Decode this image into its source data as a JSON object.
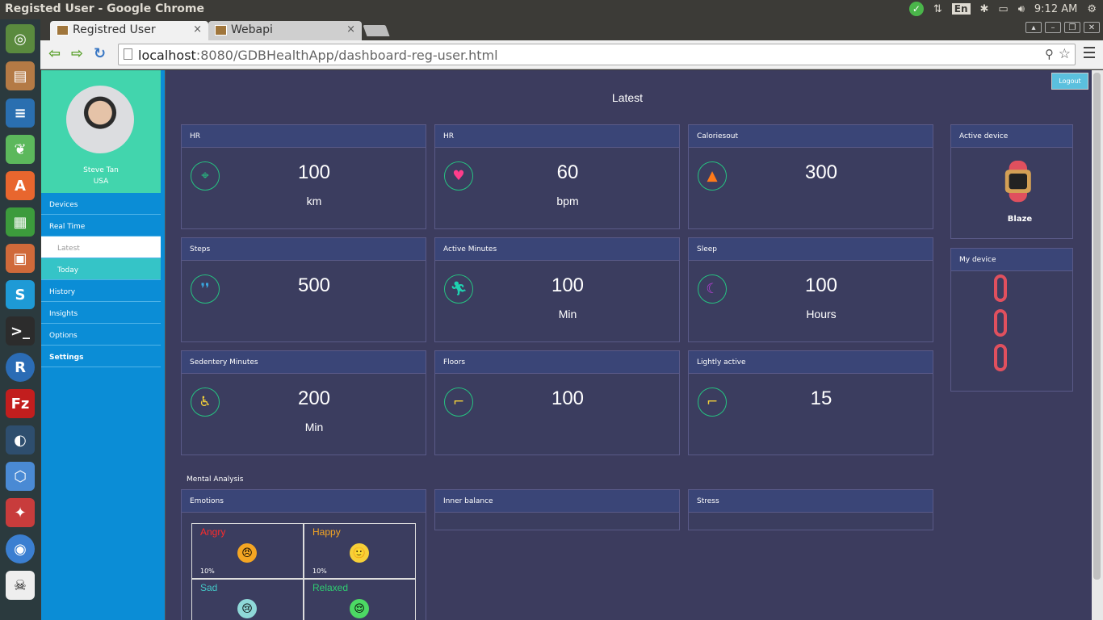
{
  "os": {
    "window_title": "Registed User - Google Chrome",
    "keyboard": "En",
    "time": "9:12 AM"
  },
  "browser": {
    "tabs": [
      {
        "label": "Registred User",
        "close": "×"
      },
      {
        "label": "Webapi",
        "close": "×"
      }
    ],
    "url_host": "localhost",
    "url_rest": ":8080/GDBHealthApp/dashboard-reg-user.html"
  },
  "profile": {
    "name": "Steve Tan",
    "country": "USA"
  },
  "sidebar": {
    "items": [
      "Devices",
      "Real Time",
      "Latest",
      "Today",
      "History",
      "Insights",
      "Options",
      "Settings"
    ]
  },
  "header": {
    "title": "Latest",
    "logout": "Logout"
  },
  "metrics": [
    {
      "title": "HR",
      "value": "100",
      "unit": "km",
      "icon": "location-pin-icon"
    },
    {
      "title": "HR",
      "value": "60",
      "unit": "bpm",
      "icon": "heart-icon"
    },
    {
      "title": "Caloriesout",
      "value": "300",
      "unit": "",
      "icon": "flame-icon"
    },
    {
      "title": "Steps",
      "value": "500",
      "unit": "",
      "icon": "footsteps-icon"
    },
    {
      "title": "Active Minutes",
      "value": "100",
      "unit": "Min",
      "icon": "running-icon"
    },
    {
      "title": "Sleep",
      "value": "100",
      "unit": "Hours",
      "icon": "moon-icon"
    },
    {
      "title": "Sedentery Minutes",
      "value": "200",
      "unit": "Min",
      "icon": "sitting-icon"
    },
    {
      "title": "Floors",
      "value": "100",
      "unit": "",
      "icon": "stairs-icon"
    },
    {
      "title": "Lightly active",
      "value": "15",
      "unit": "",
      "icon": "stairs-icon"
    }
  ],
  "active_device": {
    "title": "Active device",
    "name": "Blaze"
  },
  "my_device": {
    "title": "My device"
  },
  "mental": {
    "section_title": "Mental Analysis",
    "cards": [
      "Emotions",
      "Inner balance",
      "Stress"
    ],
    "emotions": [
      {
        "label": "Angry",
        "percent": "10%",
        "color": "#ff2b2b",
        "face": "😠"
      },
      {
        "label": "Happy",
        "percent": "10%",
        "color": "#f5a623",
        "face": "🙂"
      },
      {
        "label": "Sad",
        "percent": "",
        "color": "#43c6c6",
        "face": "😢"
      },
      {
        "label": "Relaxed",
        "percent": "",
        "color": "#2ecc71",
        "face": "😌"
      }
    ]
  },
  "colors": {
    "accent_green": "#26c281",
    "sidebar_blue": "#0b8dd6",
    "profile_teal": "#42d5ad",
    "page_bg": "#3c3c5e"
  }
}
